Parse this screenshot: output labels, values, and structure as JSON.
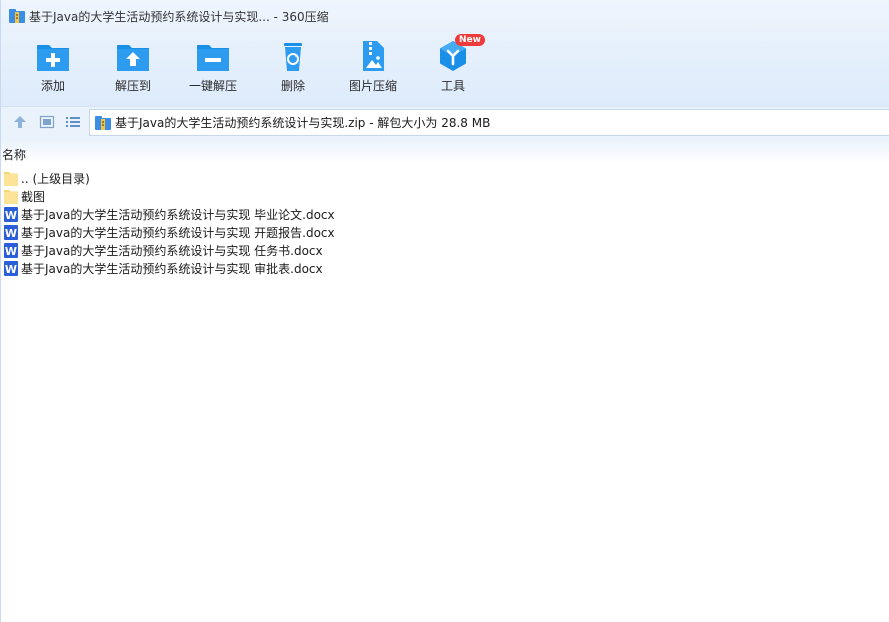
{
  "window": {
    "title": "基于Java的大学生活动预约系统设计与实现... - 360压缩"
  },
  "toolbar": {
    "items": [
      {
        "label": "添加",
        "icon": "add-folder-icon"
      },
      {
        "label": "解压到",
        "icon": "extract-to-icon"
      },
      {
        "label": "一键解压",
        "icon": "one-click-extract-icon"
      },
      {
        "label": "删除",
        "icon": "recycle-bin-icon"
      },
      {
        "label": "图片压缩",
        "icon": "image-compress-icon"
      },
      {
        "label": "工具",
        "icon": "tools-icon",
        "badge": "New"
      }
    ]
  },
  "addressbar": {
    "path": "基于Java的大学生活动预约系统设计与实现.zip - 解包大小为 28.8 MB"
  },
  "list": {
    "column_name": "名称",
    "items": [
      {
        "name": ".. (上级目录)",
        "type": "folder"
      },
      {
        "name": "截图",
        "type": "folder"
      },
      {
        "name": "基于Java的大学生活动预约系统设计与实现 毕业论文.docx",
        "type": "word"
      },
      {
        "name": "基于Java的大学生活动预约系统设计与实现 开题报告.docx",
        "type": "word"
      },
      {
        "name": "基于Java的大学生活动预约系统设计与实现 任务书.docx",
        "type": "word"
      },
      {
        "name": "基于Java的大学生活动预约系统设计与实现 审批表.docx",
        "type": "word"
      }
    ]
  },
  "colors": {
    "accent": "#1a8fe8",
    "toolbar_bg": "#ddebfb",
    "word_blue": "#2b5fd9",
    "folder_yellow": "#f7d774",
    "badge_red": "#ef3b3b"
  }
}
